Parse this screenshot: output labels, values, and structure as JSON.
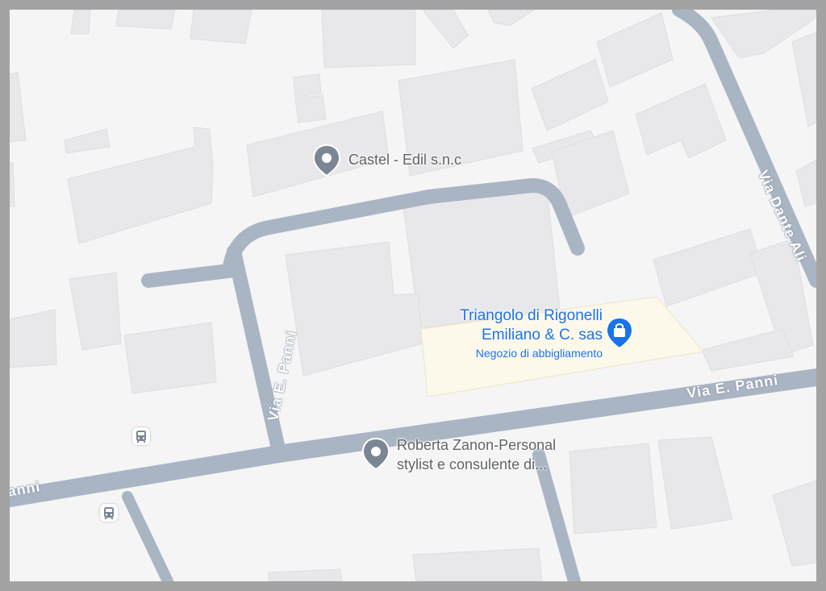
{
  "map": {
    "pois": [
      {
        "id": "castel",
        "name": "Castel - Edil s.n.c"
      },
      {
        "id": "roberta",
        "line1": "Roberta Zanon-Personal",
        "line2": "stylist e consulente di..."
      }
    ],
    "shop": {
      "name_line1": "Triangolo di Rigonelli",
      "name_line2": "Emiliano & C. sas",
      "category": "Negozio di abbigliamento"
    },
    "streets": {
      "main": "Via E. Panni",
      "vertical": "Via E. Panni",
      "left_partial": "anni",
      "right": "Via Dante Ali"
    },
    "icons": {
      "poi_pin": "map-pin-icon",
      "shop_pin": "shopping-bag-icon",
      "bus_stop": "bus-stop-icon"
    },
    "colors": {
      "background": "#f5f5f6",
      "road": "#aab5c4",
      "building": "#e8e8eb",
      "shop_area": "#fcf8ea",
      "poi_pin": "#7b8694",
      "shop_accent": "#1a73e8"
    }
  }
}
